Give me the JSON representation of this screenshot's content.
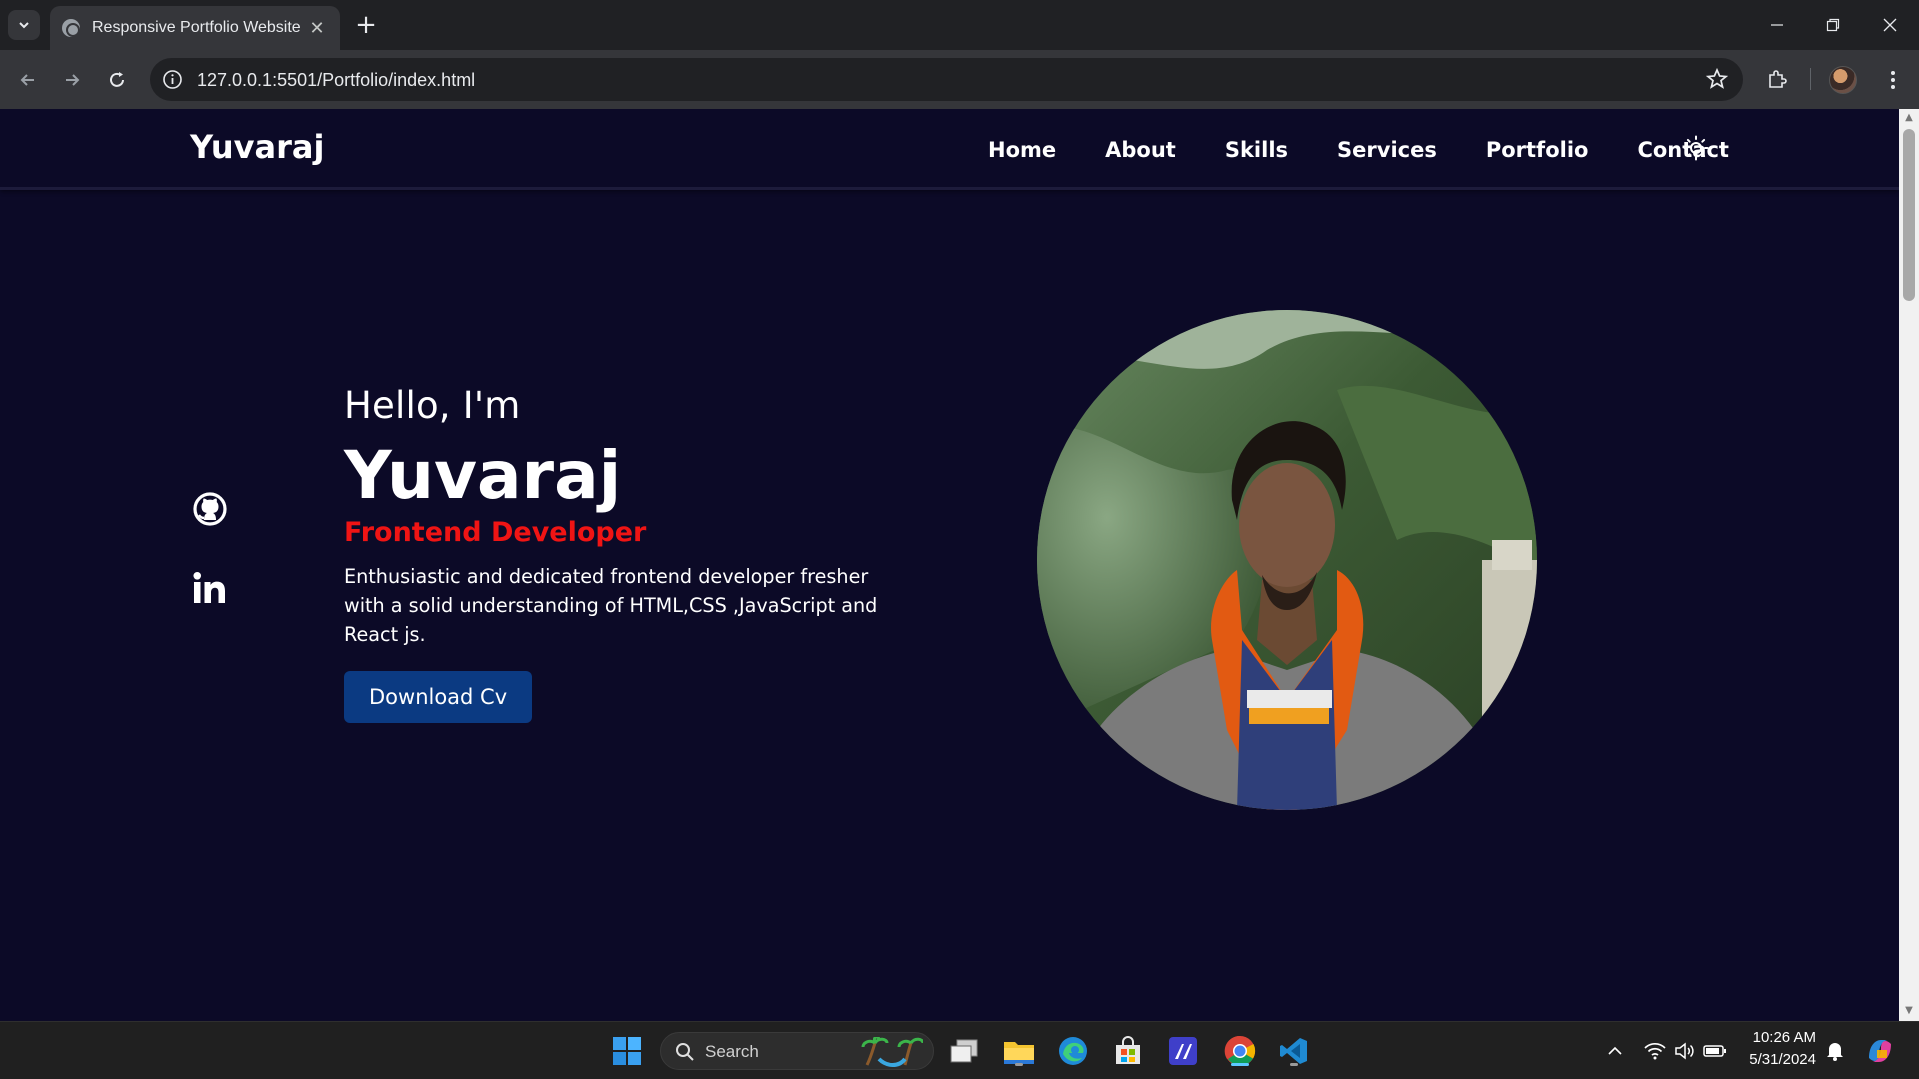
{
  "browser": {
    "tab_title": "Responsive Portfolio Website",
    "url": "127.0.0.1:5501/Portfolio/index.html"
  },
  "site": {
    "logo": "Yuvaraj",
    "nav": [
      "Home",
      "About",
      "Skills",
      "Services",
      "Portfolio",
      "Contact"
    ],
    "hero": {
      "greeting": "Hello, I'm",
      "name": "Yuvaraj",
      "role": "Frontend Developer",
      "description": "Enthusiastic and dedicated frontend developer fresher with a solid understanding of HTML,CSS ,JavaScript and React js.",
      "button": "Download Cv"
    },
    "socials": [
      "github-icon",
      "linkedin-icon"
    ],
    "colors": {
      "background": "#0c0a27",
      "role_red": "#f01414",
      "button_blue": "#0b3a82"
    }
  },
  "taskbar": {
    "search_placeholder": "Search",
    "time": "10:26 AM",
    "date": "5/31/2024"
  }
}
